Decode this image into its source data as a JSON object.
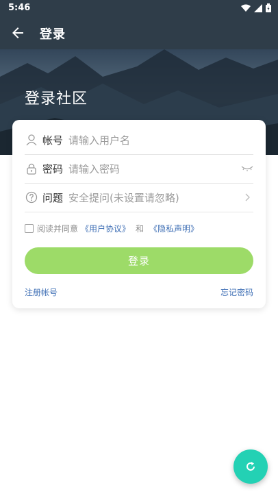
{
  "status_bar": {
    "time": "5:46",
    "icons": [
      "wifi-icon",
      "signal-icon",
      "battery-icon"
    ]
  },
  "app_bar": {
    "title": "登录",
    "back_icon": "arrow-left-icon"
  },
  "banner": {
    "headline": "登录社区"
  },
  "form": {
    "account": {
      "label": "帐号",
      "placeholder": "请输入用户名",
      "icon": "user-icon"
    },
    "password": {
      "label": "密码",
      "placeholder": "请输入密码",
      "icon": "lock-icon",
      "toggle_icon": "eye-closed-icon"
    },
    "question": {
      "label": "问题",
      "placeholder": "安全提问(未设置请忽略)",
      "icon": "help-circle-icon",
      "trail_icon": "chevron-right-icon"
    }
  },
  "agreement": {
    "prefix": "阅读并同意",
    "user_agreement": "《用户协议》",
    "and": "和",
    "privacy": "《隐私声明》",
    "checked": false
  },
  "login_button": {
    "label": "登录"
  },
  "links": {
    "register": "注册帐号",
    "forgot": "忘记密码"
  },
  "fab": {
    "icon": "refresh-icon"
  },
  "colors": {
    "app_bar": "#2f3d49",
    "accent_green": "#9ddb68",
    "link_blue": "#3f6fb5",
    "fab_teal": "#23d1b4"
  }
}
